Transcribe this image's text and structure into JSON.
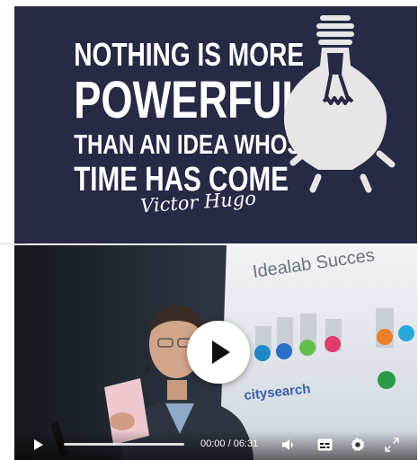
{
  "quote": {
    "lines": [
      "NOTHING IS MORE",
      "POWERFUL",
      "THAN AN IDEA WHOSE",
      "TIME HAS COME"
    ],
    "author": "Victor Hugo",
    "background_color": "#272a45",
    "bulb_color": "#e6e6e6"
  },
  "video": {
    "slide_title": "Idealab Succes",
    "slide_logo_text": "citysearch",
    "big_play_icon": "play-icon",
    "controls": {
      "time_display": "00:00 / 06:31",
      "progress_fraction": 0,
      "icons": [
        "play-icon",
        "volume-icon",
        "captions-icon",
        "gear-icon",
        "fullscreen-icon"
      ]
    }
  }
}
